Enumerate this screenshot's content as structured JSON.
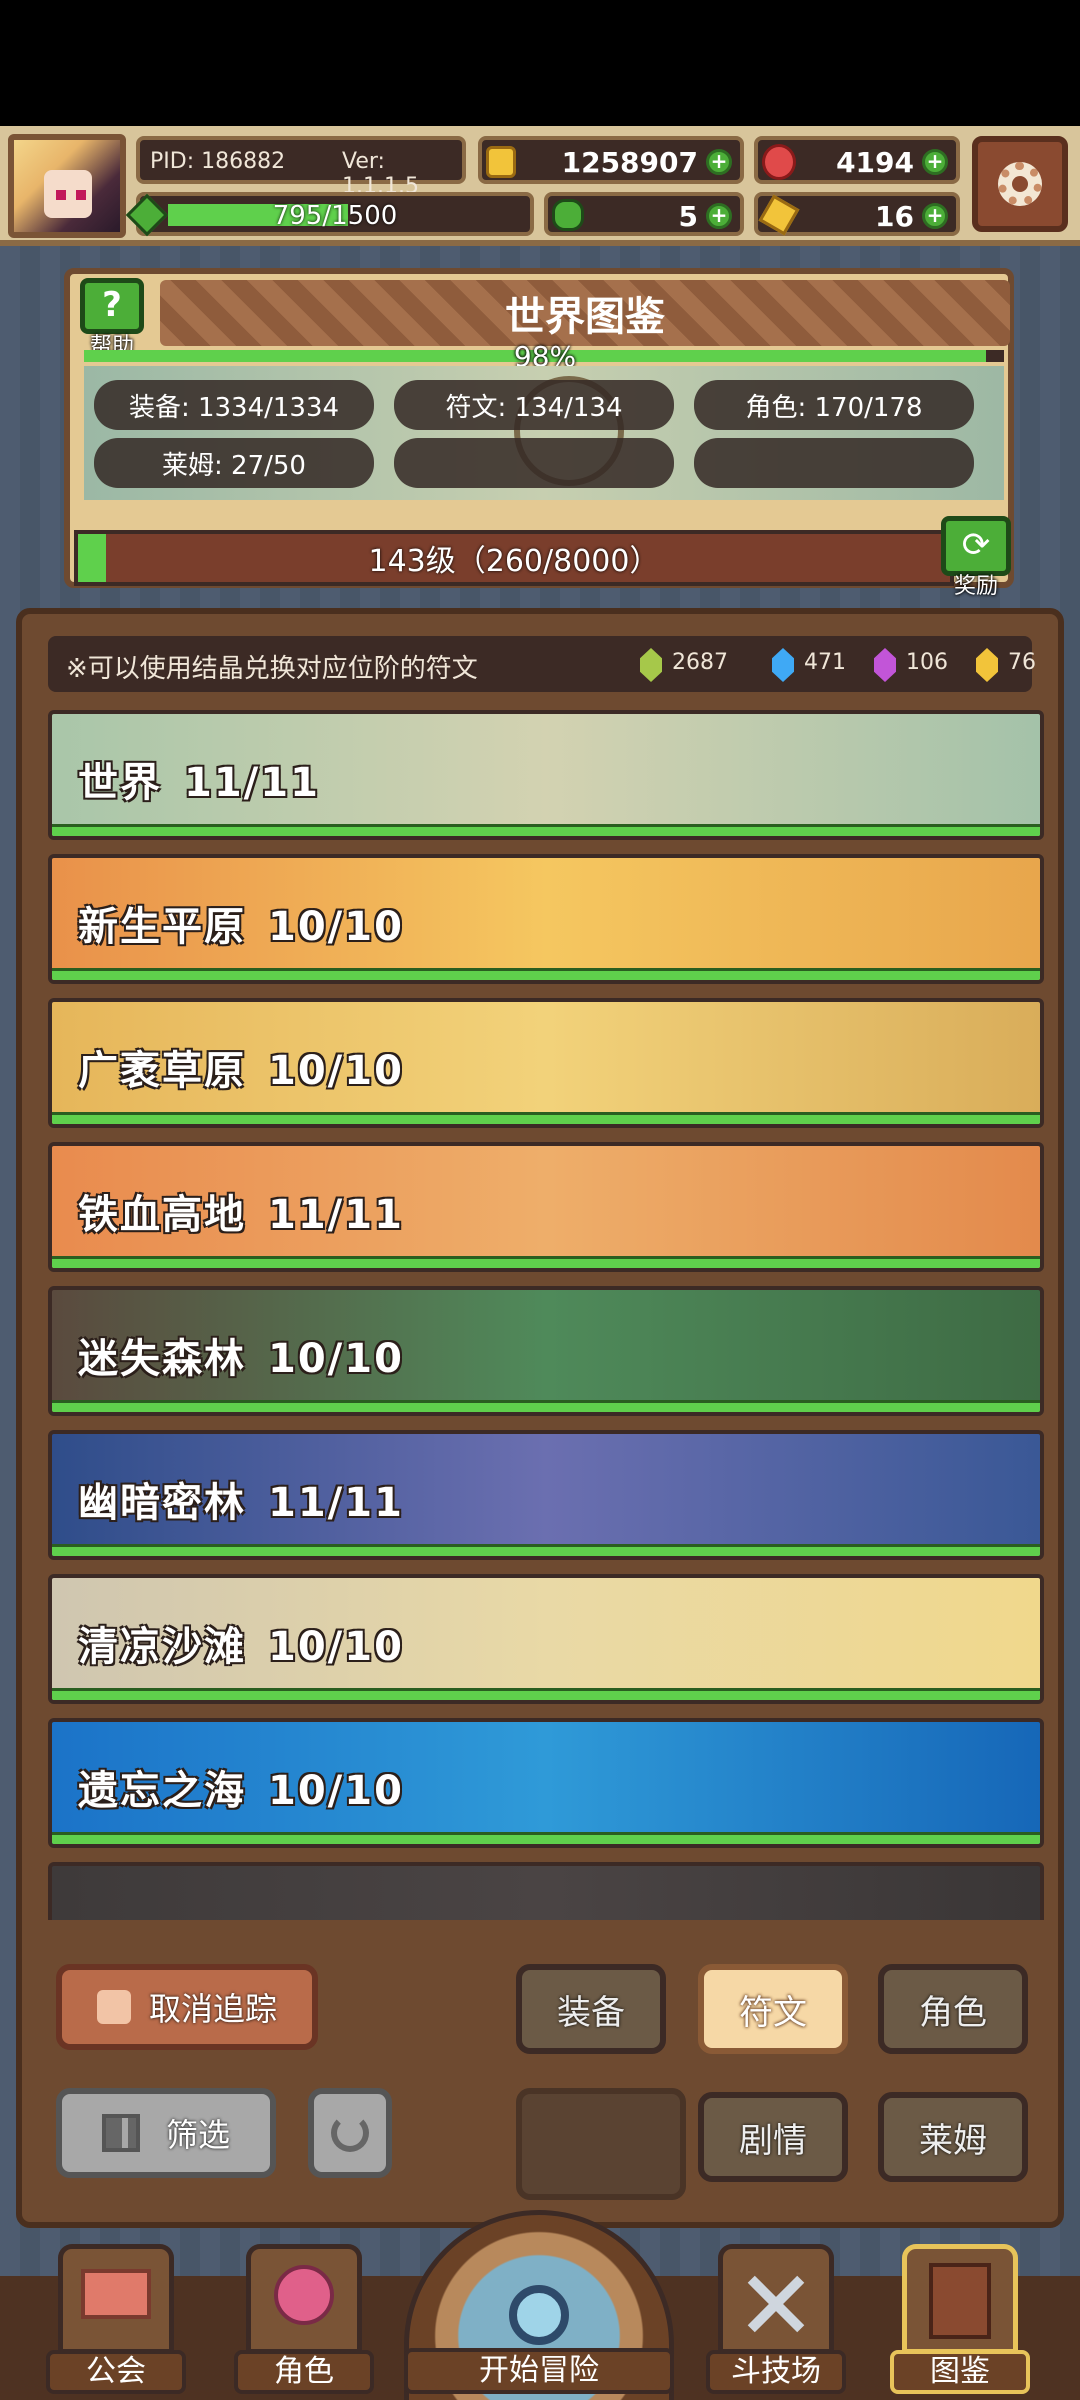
{
  "player": {
    "pid_label": "PID: 186882",
    "version_label": "Ver: 1.1.1.5",
    "gold": "1258907",
    "ruby": "4194",
    "stamina": "795/1500",
    "stamina_fraction": 0.53,
    "clover": "5",
    "key": "16"
  },
  "world": {
    "title": "世界图鉴",
    "percent": "98%",
    "percent_value": 0.98,
    "help_label": "帮助",
    "reward_label": "奖励",
    "stats": [
      "装备: 1334/1334",
      "符文: 134/134",
      "角色: 170/178",
      "莱姆: 27/50"
    ],
    "level_text": "143级（260/8000）",
    "level_fraction": 0.0325
  },
  "notice": {
    "text": "※可以使用结晶兑换对应位阶的符文",
    "gems": [
      {
        "color": "#a6c84a",
        "value": "2687"
      },
      {
        "color": "#3fa9f5",
        "value": "471"
      },
      {
        "color": "#c255d8",
        "value": "106"
      },
      {
        "color": "#f2c43a",
        "value": "76"
      }
    ]
  },
  "regions": [
    {
      "name": "世界",
      "count": "11/11",
      "colors": [
        "#a9c6a9",
        "#d3d2b1",
        "#a4c2a9"
      ]
    },
    {
      "name": "新生平原",
      "count": "10/10",
      "colors": [
        "#e9914a",
        "#f5c760",
        "#e8a64c"
      ]
    },
    {
      "name": "广袤草原",
      "count": "10/10",
      "colors": [
        "#e6b65a",
        "#f2d27a",
        "#d9ad5a"
      ]
    },
    {
      "name": "铁血高地",
      "count": "11/11",
      "colors": [
        "#e98b4e",
        "#eeae6a",
        "#e38a4c"
      ]
    },
    {
      "name": "迷失森林",
      "count": "10/10",
      "colors": [
        "#5a4a3e",
        "#4f8a5a",
        "#3e6b44"
      ]
    },
    {
      "name": "幽暗密林",
      "count": "11/11",
      "colors": [
        "#2f4d8a",
        "#6b6fb0",
        "#3a5896"
      ]
    },
    {
      "name": "清凉沙滩",
      "count": "10/10",
      "colors": [
        "#cfc6b0",
        "#e9d9a6",
        "#f0d88c"
      ]
    },
    {
      "name": "遗忘之海",
      "count": "10/10",
      "colors": [
        "#1b73c8",
        "#2f9ad8",
        "#1667b8"
      ]
    },
    {
      "name": "",
      "count": "",
      "colors": [
        "#3e3a3a",
        "#4a4444",
        "#3a3636"
      ]
    }
  ],
  "controls": {
    "untrack": "取消追踪",
    "filter": "筛选",
    "equipment": "装备",
    "rune": "符文",
    "character": "角色",
    "story": "剧情",
    "slime": "莱姆"
  },
  "nav": {
    "guild": "公会",
    "character": "角色",
    "adventure": "开始冒险",
    "arena": "斗技场",
    "codex": "图鉴"
  }
}
